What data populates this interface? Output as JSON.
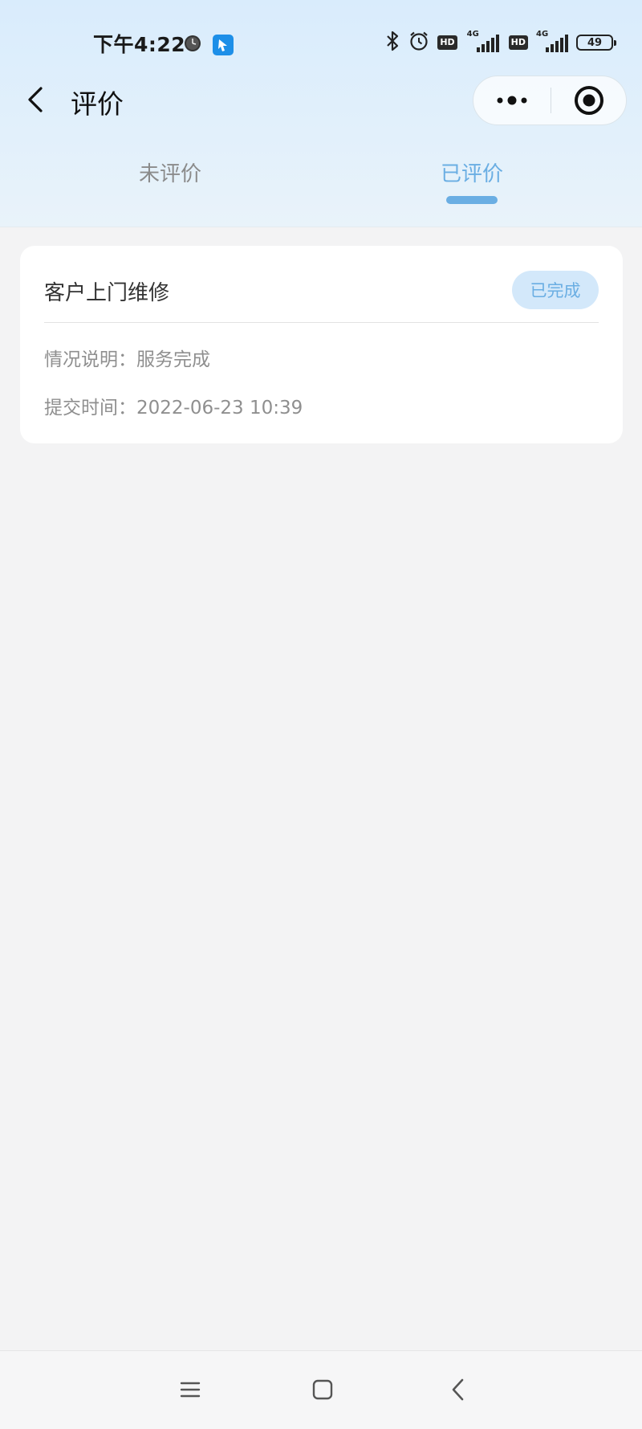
{
  "status_bar": {
    "time": "下午4:22",
    "network_1": "4G",
    "network_2": "4G",
    "hd_1": "HD",
    "hd_2": "HD",
    "battery": "49"
  },
  "nav": {
    "title": "评价"
  },
  "tabs": [
    {
      "label": "未评价",
      "active": false
    },
    {
      "label": "已评价",
      "active": true
    }
  ],
  "records": [
    {
      "title": "客户上门维修",
      "status": "已完成",
      "desc_label": "情况说明：",
      "desc_value": "服务完成",
      "time_label": "提交时间：",
      "time_value": "2022-06-23 10:39"
    }
  ],
  "colors": {
    "accent": "#6aaee3",
    "badge_bg": "#d3e8fa",
    "page_bg": "#f3f3f4"
  },
  "icons": {
    "back": "chevron-left-icon",
    "more": "more-dots-icon",
    "close": "target-circle-icon",
    "bluetooth": "bluetooth-icon",
    "alarm": "alarm-icon",
    "menu": "menu-lines-icon",
    "home": "home-square-icon",
    "sys_back": "back-chevron-icon"
  }
}
